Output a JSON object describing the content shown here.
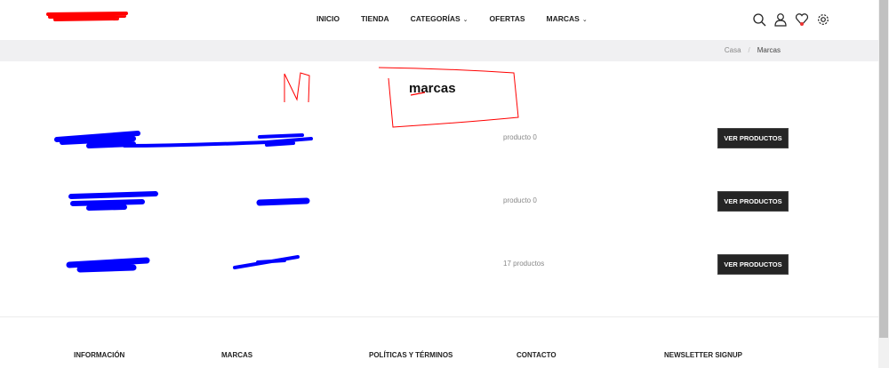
{
  "nav": {
    "items": [
      "INICIO",
      "TIENDA",
      "CATEGORÍAS",
      "OFERTAS",
      "MARCAS"
    ]
  },
  "header_icons": [
    "search-icon",
    "user-icon",
    "heart-icon",
    "gear-icon"
  ],
  "breadcrumb": {
    "home": "Casa",
    "separator": "/",
    "current": "Marcas"
  },
  "page": {
    "title": "marcas"
  },
  "brands": [
    {
      "count": "producto 0",
      "button": "VER PRODUCTOS"
    },
    {
      "count": "producto 0",
      "button": "VER PRODUCTOS"
    },
    {
      "count": "17 productos",
      "button": "VER PRODUCTOS"
    }
  ],
  "footer": {
    "columns": [
      "INFORMACIÓN",
      "MARCAS",
      "POLÍTICAS Y TÉRMINOS",
      "CONTACTO",
      "NEWSLETTER SIGNUP"
    ]
  },
  "colors": {
    "button": "#252525",
    "crumbbar": "#f0f0f2",
    "annotation_red": "#ff0000",
    "annotation_blue": "#0000ff"
  }
}
